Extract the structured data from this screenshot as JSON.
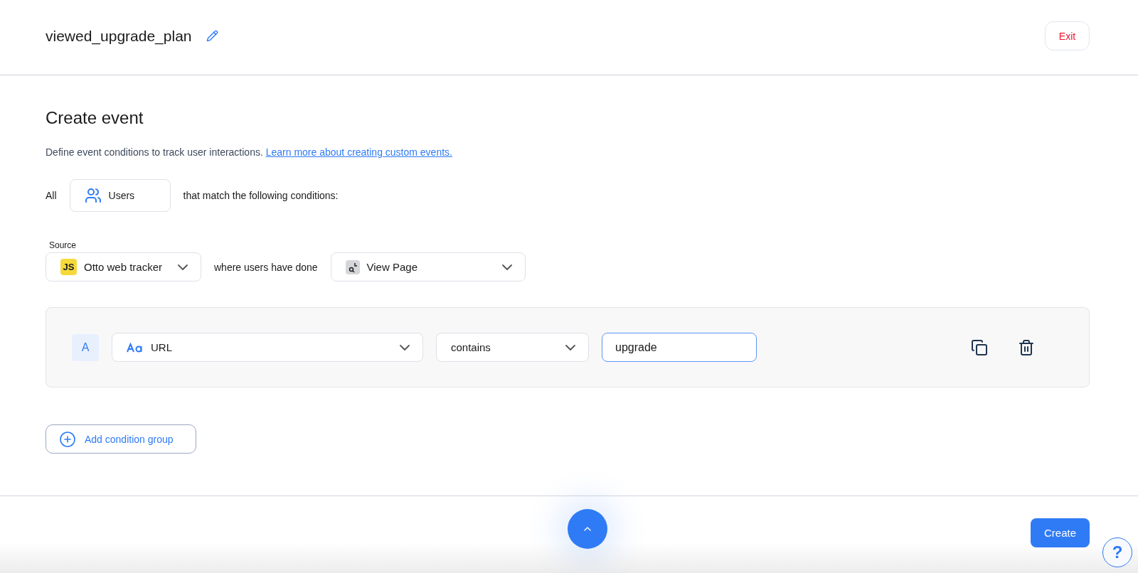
{
  "header": {
    "title": "viewed_upgrade_plan",
    "exit": "Exit"
  },
  "heading": "Create event",
  "description": {
    "text": "Define event conditions to track user interactions.",
    "link": "Learn more about creating custom events."
  },
  "audience": {
    "prefix": "All",
    "value": "Users",
    "suffix": "that match the following conditions:"
  },
  "source": {
    "label": "Source",
    "badge": "JS",
    "value": "Otto web tracker"
  },
  "connector": "where users have done",
  "event": {
    "value": "View Page"
  },
  "conditions": [
    {
      "label": "A",
      "property": "URL",
      "operator": "contains",
      "value": "upgrade",
      "focused": true
    }
  ],
  "add_group": "Add condition group",
  "footer": {
    "create": "Create",
    "help": "?"
  }
}
